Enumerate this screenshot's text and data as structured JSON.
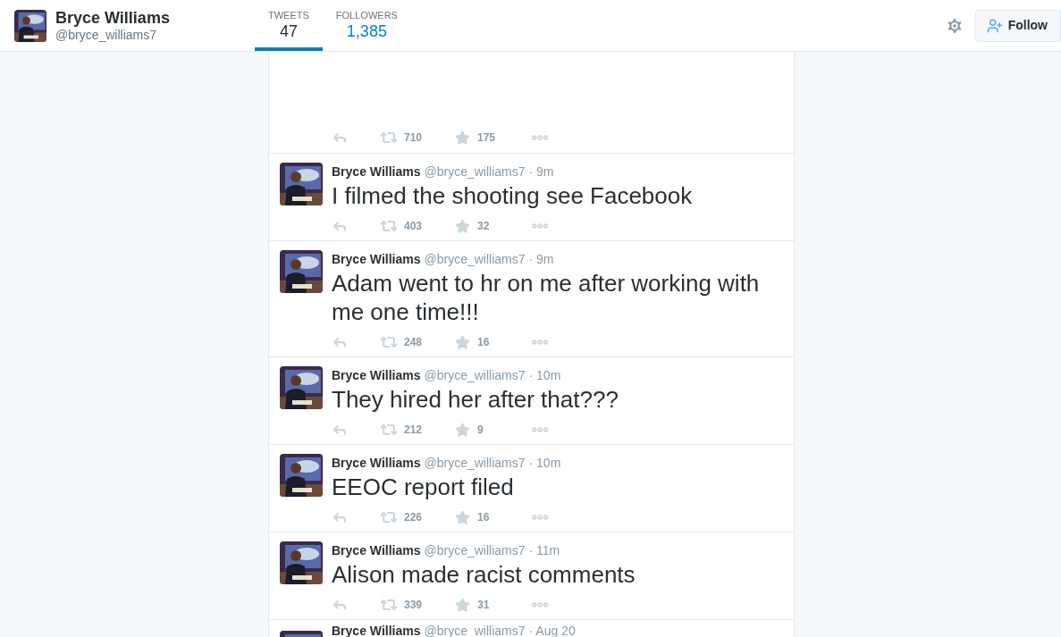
{
  "profile": {
    "name": "Bryce Williams",
    "handle": "@bryce_williams7"
  },
  "stats": [
    {
      "label": "TWEETS",
      "count": "47",
      "selected": true
    },
    {
      "label": "FOLLOWERS",
      "count": "1,385",
      "selected": false
    }
  ],
  "follow_button": "Follow",
  "tweets": [
    {
      "kind": "actions_only",
      "retweets": "710",
      "favorites": "175"
    },
    {
      "kind": "tweet",
      "name": "Bryce Williams",
      "handle": "@bryce_williams7",
      "time": "· 9m",
      "text": "I filmed the shooting see Facebook",
      "retweets": "403",
      "favorites": "32"
    },
    {
      "kind": "tweet",
      "name": "Bryce Williams",
      "handle": "@bryce_williams7",
      "time": "· 9m",
      "text": "Adam went to hr on me after working with me one time!!!",
      "retweets": "248",
      "favorites": "16"
    },
    {
      "kind": "tweet",
      "name": "Bryce Williams",
      "handle": "@bryce_williams7",
      "time": "· 10m",
      "text": "They hired her after that???",
      "retweets": "212",
      "favorites": "9"
    },
    {
      "kind": "tweet",
      "name": "Bryce Williams",
      "handle": "@bryce_williams7",
      "time": "· 10m",
      "text": "EEOC report filed",
      "retweets": "226",
      "favorites": "16"
    },
    {
      "kind": "tweet",
      "name": "Bryce Williams",
      "handle": "@bryce_williams7",
      "time": "· 11m",
      "text": "Alison made racist comments",
      "retweets": "339",
      "favorites": "31"
    },
    {
      "kind": "header_only",
      "name": "Bryce Williams",
      "handle": "@bryce_williams7",
      "time": "· Aug 20"
    }
  ]
}
